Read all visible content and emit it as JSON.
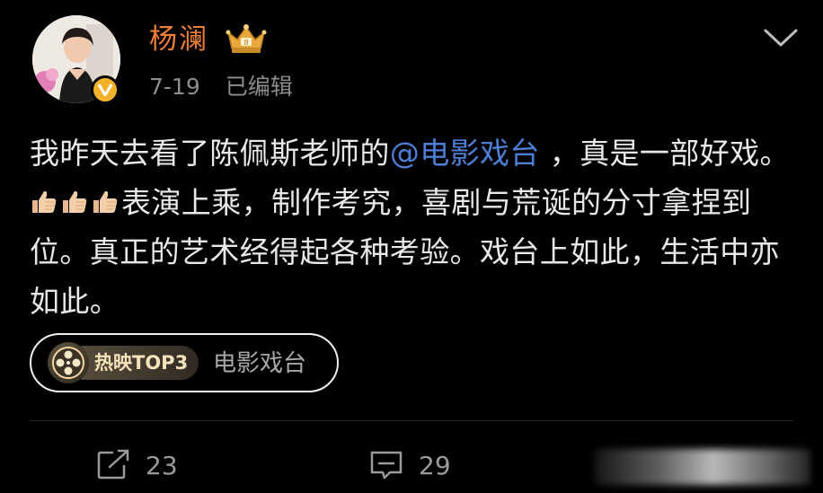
{
  "header": {
    "username": "杨澜",
    "date": "7-19",
    "edited": "已编辑"
  },
  "post": {
    "text_before": "我昨天去看了陈佩斯老师的",
    "mention": "@电影戏台",
    "text_after_mention": " ，真是一部好戏。",
    "thumbs_icon": "thumbs-up-emoji",
    "thumbs_count": 3,
    "text_after_emoji": "表演上乘，制作考究，喜剧与荒诞的分寸拿捏到位。真正的艺术经得起各种考验。戏台上如此，生活中亦如此。"
  },
  "tag_chip": {
    "badge": "热映TOP3",
    "label": "电影戏台"
  },
  "actions": {
    "repost_count": "23",
    "comment_count": "29"
  },
  "colors": {
    "username": "#f07f36",
    "mention": "#4d7fd6",
    "verified": "#f3b22a",
    "background": "#000000"
  }
}
